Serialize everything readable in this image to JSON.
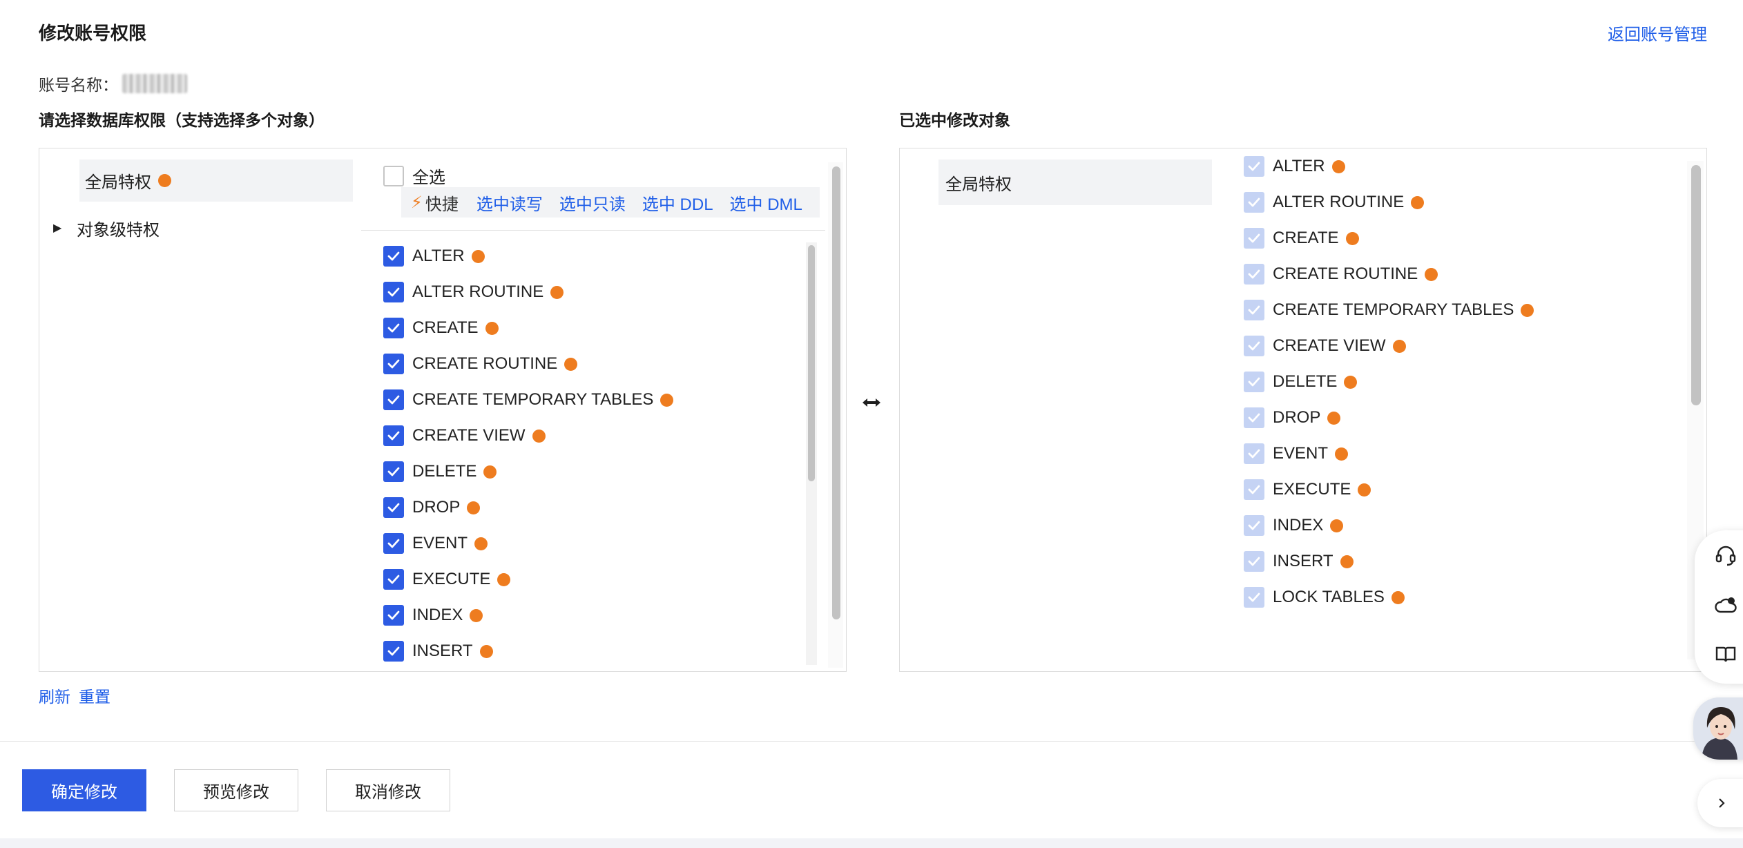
{
  "header": {
    "title": "修改账号权限",
    "back_link": "返回账号管理"
  },
  "account": {
    "label": "账号名称：",
    "value_blurred": true
  },
  "left_section": {
    "title": "请选择数据库权限（支持选择多个对象）",
    "tree": {
      "global": "全局特权",
      "object_level": "对象级特权"
    },
    "select_all": "全选",
    "quick": {
      "label": "快捷",
      "actions": [
        "选中读写",
        "选中只读",
        "选中 DDL",
        "选中 DML"
      ]
    },
    "privileges": [
      {
        "label": "ALTER",
        "checked": true
      },
      {
        "label": "ALTER ROUTINE",
        "checked": true
      },
      {
        "label": "CREATE",
        "checked": true
      },
      {
        "label": "CREATE ROUTINE",
        "checked": true
      },
      {
        "label": "CREATE TEMPORARY TABLES",
        "checked": true
      },
      {
        "label": "CREATE VIEW",
        "checked": true
      },
      {
        "label": "DELETE",
        "checked": true
      },
      {
        "label": "DROP",
        "checked": true
      },
      {
        "label": "EVENT",
        "checked": true
      },
      {
        "label": "EXECUTE",
        "checked": true
      },
      {
        "label": "INDEX",
        "checked": true
      },
      {
        "label": "INSERT",
        "checked": true
      }
    ]
  },
  "right_section": {
    "title": "已选中修改对象",
    "tree": {
      "global": "全局特权"
    },
    "privileges": [
      "ALTER",
      "ALTER ROUTINE",
      "CREATE",
      "CREATE ROUTINE",
      "CREATE TEMPORARY TABLES",
      "CREATE VIEW",
      "DELETE",
      "DROP",
      "EVENT",
      "EXECUTE",
      "INDEX",
      "INSERT",
      "LOCK TABLES"
    ]
  },
  "footer_links": {
    "refresh": "刷新",
    "reset": "重置"
  },
  "buttons": {
    "confirm": "确定修改",
    "preview": "预览修改",
    "cancel": "取消修改"
  },
  "colors": {
    "primary": "#2d5be3",
    "link": "#1f5ee8",
    "dot": "#ee7c1f",
    "disabled_check": "#c5d3f4"
  }
}
